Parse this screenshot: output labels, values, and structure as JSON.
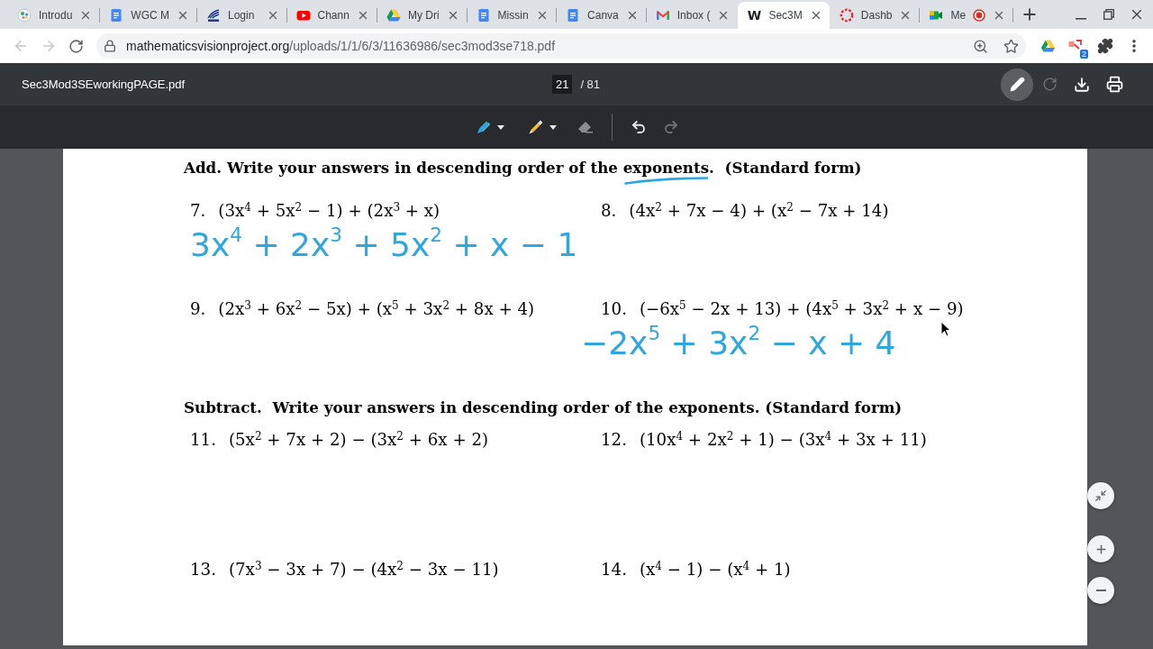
{
  "tabs": [
    {
      "title": "Introdu",
      "selected": false,
      "recording": false
    },
    {
      "title": "WGC M",
      "selected": false,
      "recording": false
    },
    {
      "title": "Login",
      "selected": false,
      "recording": false
    },
    {
      "title": "Chann",
      "selected": false,
      "recording": false
    },
    {
      "title": "My Dri",
      "selected": false,
      "recording": false
    },
    {
      "title": "Missin",
      "selected": false,
      "recording": false
    },
    {
      "title": "Canva",
      "selected": false,
      "recording": false
    },
    {
      "title": "Inbox (",
      "selected": false,
      "recording": false
    },
    {
      "title": "Sec3M",
      "logo_text": "W",
      "selected": true,
      "recording": false
    },
    {
      "title": "Dashb",
      "selected": false,
      "recording": false
    },
    {
      "title": "Me",
      "selected": false,
      "recording": true
    }
  ],
  "navigation": {
    "back_disabled": true,
    "forward_disabled": true
  },
  "address_bar": {
    "host": "mathematicsvisionproject.org",
    "path": "/uploads/1/1/6/3/11636986/sec3mod3se718.pdf"
  },
  "extensions": {
    "badge": "2"
  },
  "pdf_toolbar": {
    "title": "Sec3Mod3SEworkingPAGE.pdf",
    "page": "21",
    "page_total": "/ 81",
    "annotate_on": true,
    "rotate_disabled": true
  },
  "annotation_toolbar": {
    "redo_disabled": true
  },
  "document": {
    "sections": [
      {
        "heading": "Add. Write your answers in descending order of the exponents.  (Standard form)",
        "problems": [
          {
            "number": "7.",
            "expression": "(3x$^{4}$ + 5x$^{2}$ − 1) + (2x$^{3}$ + x)",
            "answer": "3x$^{4}$ + 2x$^{3}$ + 5x$^{2}$ + x − 1"
          },
          {
            "number": "8.",
            "expression": "(4x$^{2}$ + 7x − 4) + (x$^{2}$ − 7x + 14)"
          },
          {
            "number": "9.",
            "expression": "(2x$^{3}$ + 6x$^{2}$ − 5x) + (x$^{5}$ + 3x$^{2}$ + 8x + 4)"
          },
          {
            "number": "10.",
            "expression": "(−6x$^{5}$ − 2x + 13) + (4x$^{5}$ + 3x$^{2}$ + x − 9)",
            "answer": "−2x$^{5}$ + 3x$^{2}$ − x + 4"
          }
        ]
      },
      {
        "heading": "Subtract.  Write your answers in descending order of the exponents. (Standard form)",
        "problems": [
          {
            "number": "11.",
            "expression": "(5x$^{2}$ + 7x + 2) − (3x$^{2}$ + 6x + 2)"
          },
          {
            "number": "12.",
            "expression": "(10x$^{4}$ + 2x$^{2}$ + 1) − (3x$^{4}$ + 3x + 11)"
          },
          {
            "number": "13.",
            "expression": "(7x$^{3}$ − 3x + 7) − (4x$^{2}$ − 3x − 11)"
          },
          {
            "number": "14.",
            "expression": "(x$^{4}$ − 1) − (x$^{4}$ + 1)"
          }
        ]
      }
    ]
  }
}
